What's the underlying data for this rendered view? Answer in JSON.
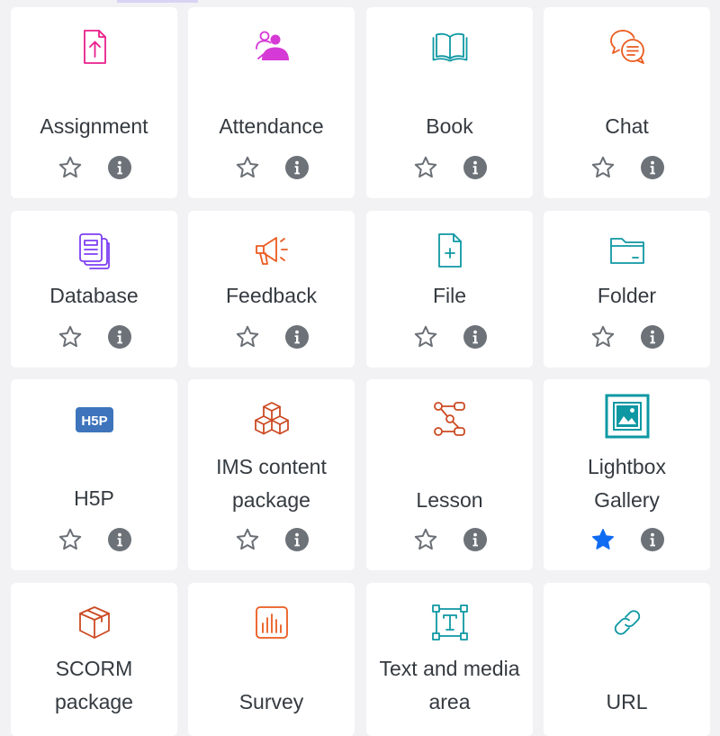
{
  "colors": {
    "assignment": "#e91e8c",
    "attendance": "#d63ad6",
    "teal": "#0e98a3",
    "orange": "#ea5b1f",
    "purple": "#7e3ff2",
    "red": "#cc4a23",
    "h5p": "#3d74bc",
    "star_default": "#6a6f75",
    "star_active": "#0f6cf2",
    "info": "#6c7278"
  },
  "activities": [
    {
      "name": "Assignment",
      "icon": "file-upload-icon",
      "starred": false
    },
    {
      "name": "Attendance",
      "icon": "people-icon",
      "starred": false
    },
    {
      "name": "Book",
      "icon": "book-icon",
      "starred": false
    },
    {
      "name": "Chat",
      "icon": "chat-bubbles-icon",
      "starred": false
    },
    {
      "name": "Database",
      "icon": "database-icon",
      "starred": false
    },
    {
      "name": "Feedback",
      "icon": "megaphone-icon",
      "starred": false
    },
    {
      "name": "File",
      "icon": "file-icon",
      "starred": false
    },
    {
      "name": "Folder",
      "icon": "folder-icon",
      "starred": false
    },
    {
      "name": "H5P",
      "icon": "h5p-logo-icon",
      "logo_text": "H5P",
      "starred": false
    },
    {
      "name_lines": [
        "IMS content",
        "package"
      ],
      "icon": "cubes-icon",
      "starred": false
    },
    {
      "name": "Lesson",
      "icon": "flow-diagram-icon",
      "starred": false
    },
    {
      "name_lines": [
        "Lightbox",
        "Gallery"
      ],
      "icon": "picture-frame-icon",
      "starred": true
    },
    {
      "name_lines": [
        "SCORM",
        "package"
      ],
      "icon": "package-box-icon",
      "starred": false
    },
    {
      "name": "Survey",
      "icon": "bar-chart-icon",
      "starred": false
    },
    {
      "name_lines": [
        "Text and media",
        "area"
      ],
      "icon": "text-box-icon",
      "starred": false
    },
    {
      "name": "URL",
      "icon": "link-icon",
      "starred": false
    }
  ]
}
